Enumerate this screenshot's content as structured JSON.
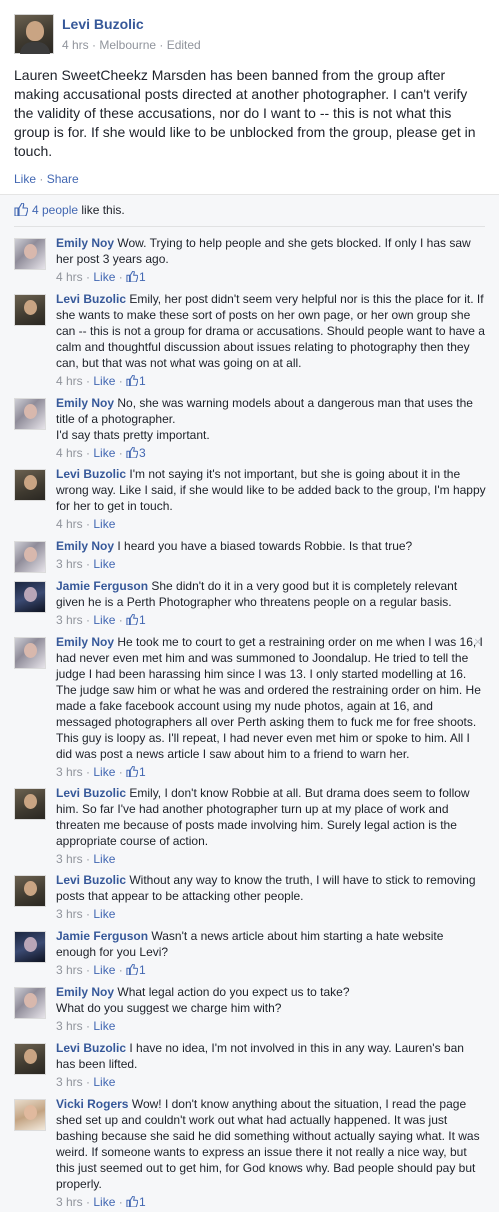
{
  "post": {
    "author": "Levi Buzolic",
    "meta": "4 hrs · Melbourne · Edited",
    "body": "Lauren SweetCheekz Marsden has been banned from the group after making accusational posts directed at another photographer. I can't verify the validity of these accusations, nor do I want to -- this is not what this group is for. If she would like to be unblocked from the group, please get in touch.",
    "like_label": "Like",
    "share_label": "Share",
    "likes_link": "4 people",
    "likes_suffix": " like this."
  },
  "comments": [
    {
      "name": "Emily Noy",
      "text": "Wow. Trying to help people and she gets blocked. If only I has saw her post 3 years ago.",
      "time": "4 hrs",
      "like": "Like",
      "count": "1"
    },
    {
      "name": "Levi Buzolic",
      "text": "Emily, her post didn't seem very helpful nor is this the place for it. If she wants to make these sort of posts on her own page, or her own group she can -- this is not a group for drama or accusations. Should people want to have a calm and thoughtful discussion about issues relating to photography then they can, but that was not what was going on at all.",
      "time": "4 hrs",
      "like": "Like",
      "count": "1"
    },
    {
      "name": "Emily Noy",
      "text": "No, she was warning models about a dangerous man that uses the title of a photographer.\nI'd say thats pretty important.",
      "time": "4 hrs",
      "like": "Like",
      "count": "3"
    },
    {
      "name": "Levi Buzolic",
      "text": "I'm not saying it's not important, but she is going about it in the wrong way. Like I said, if she would like to be added back to the group, I'm happy for her to get in touch.",
      "time": "4 hrs",
      "like": "Like",
      "count": ""
    },
    {
      "name": "Emily Noy",
      "text": "I heard you have a biased towards Robbie. Is that true?",
      "time": "3 hrs",
      "like": "Like",
      "count": ""
    },
    {
      "name": "Jamie Ferguson",
      "text": "She didn't do it in a very good but it is completely relevant given he is a Perth Photographer who threatens people on a regular basis.",
      "time": "3 hrs",
      "like": "Like",
      "count": "1"
    },
    {
      "name": "Emily Noy",
      "text": "He took me to court to get a restraining order on me when I was 16, I had never even met him and was summoned to Joondalup. He tried to tell the judge I had been harassing him since I was 13. I only started modelling at 16. The judge saw him or what he was and ordered the restraining order on him. He made a fake facebook account using my nude photos, again at 16, and messaged photographers all over Perth asking them to fuck me for free shoots. This guy is loopy as. I'll repeat, I had never even met him or spoke to him. All I did was post a news article I saw about him to a friend to warn her.",
      "time": "3 hrs",
      "like": "Like",
      "count": "1"
    },
    {
      "name": "Levi Buzolic",
      "text": "Emily, I don't know Robbie at all. But drama does seem to follow him. So far I've had another photographer turn up at my place of work and threaten me because of posts made involving him. Surely legal action is the appropriate course of action.",
      "time": "3 hrs",
      "like": "Like",
      "count": ""
    },
    {
      "name": "Levi Buzolic",
      "text": "Without any way to know the truth, I will have to stick to removing posts that appear to be attacking other people.",
      "time": "3 hrs",
      "like": "Like",
      "count": ""
    },
    {
      "name": "Jamie Ferguson",
      "text": "Wasn't a news article about him starting a hate website enough for you Levi?",
      "time": "3 hrs",
      "like": "Like",
      "count": "1"
    },
    {
      "name": "Emily Noy",
      "text": "What legal action do you expect us to take?\nWhat do you suggest we charge him with?",
      "time": "3 hrs",
      "like": "Like",
      "count": ""
    },
    {
      "name": "Levi Buzolic",
      "text": "I have no idea, I'm not involved in this in any way. Lauren's ban has been lifted.",
      "time": "3 hrs",
      "like": "Like",
      "count": ""
    },
    {
      "name": "Vicki Rogers",
      "text": "Wow! I don't know anything about the situation, I read the page shed set up and couldn't work out what had actually happened. It was just bashing because she said he did something without actually saying what. It was weird. If someone wants to express an issue there it not really a nice way, but this just seemed out to get him, for God knows why. Bad people should pay but properly.",
      "time": "3 hrs",
      "like": "Like",
      "count": "1"
    }
  ],
  "colors": {
    "link": "#4267b2",
    "name": "#365899",
    "meta": "#90949c",
    "comments_bg": "#f6f7f9"
  }
}
